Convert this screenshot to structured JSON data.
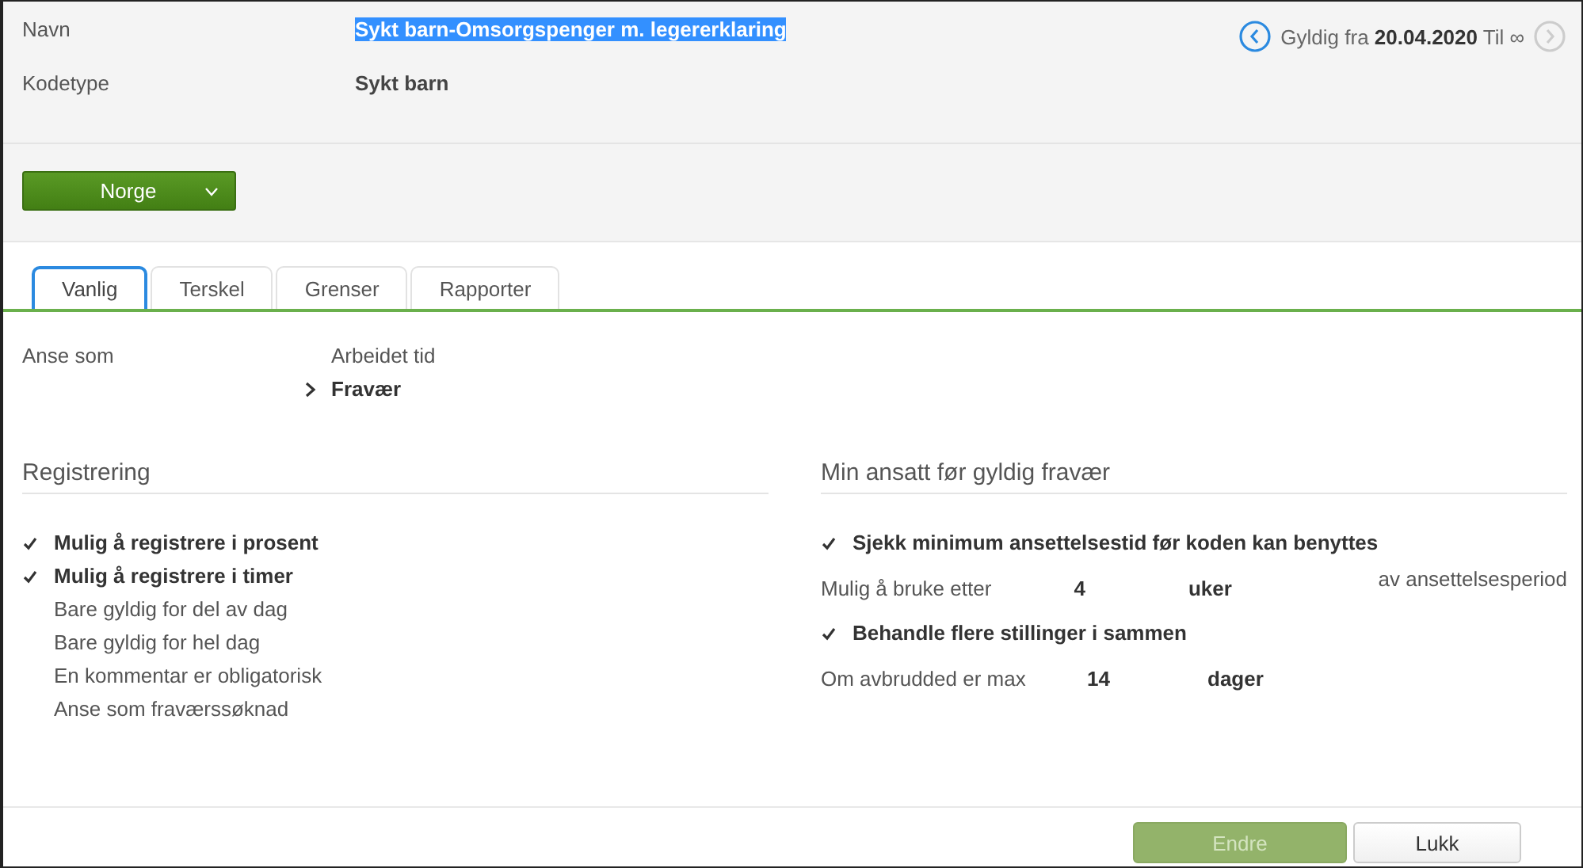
{
  "header": {
    "fields": [
      {
        "label": "Navn",
        "value": "Sykt barn-Omsorgspenger m. legererklaring",
        "highlighted": true
      },
      {
        "label": "Kodetype",
        "value": "Sykt barn",
        "highlighted": false
      }
    ],
    "validity": {
      "prefix": "Gyldig fra",
      "date": "20.04.2020",
      "suffix": "Til ∞",
      "prev_disabled": false,
      "next_disabled": true
    }
  },
  "country_button": {
    "label": "Norge"
  },
  "tabs": [
    {
      "label": "Vanlig",
      "selected": true
    },
    {
      "label": "Terskel",
      "selected": false
    },
    {
      "label": "Grenser",
      "selected": false
    },
    {
      "label": "Rapporter",
      "selected": false
    }
  ],
  "anse_som": {
    "label": "Anse som",
    "options": [
      {
        "label": "Arbeidet tid",
        "selected": false
      },
      {
        "label": "Fravær",
        "selected": true
      }
    ]
  },
  "registrering": {
    "title": "Registrering",
    "items": [
      {
        "label": "Mulig å registrere i prosent",
        "checked": true
      },
      {
        "label": "Mulig å registrere i timer",
        "checked": true
      },
      {
        "label": "Bare gyldig for del av dag",
        "checked": false
      },
      {
        "label": "Bare gyldig for hel dag",
        "checked": false
      },
      {
        "label": "En kommentar er obligatorisk",
        "checked": false
      },
      {
        "label": "Anse som fraværssøknad",
        "checked": false
      }
    ]
  },
  "min_ansatt": {
    "title": "Min ansatt før gyldig fravær",
    "rows": [
      {
        "kind": "check",
        "label": "Sjekk minimum ansettelsestid før koden kan benyttes",
        "checked": true
      },
      {
        "kind": "field",
        "label": "Mulig å bruke etter",
        "value": "4",
        "unit": "uker",
        "note": "av ansettelsesperiod"
      },
      {
        "kind": "check",
        "label": "Behandle flere stillinger i sammen",
        "checked": true
      },
      {
        "kind": "field",
        "label": "Om avbrudded er max",
        "value": "14",
        "unit": "dager"
      }
    ]
  },
  "footer": {
    "buttons": [
      {
        "label": "Endre",
        "disabled": true,
        "kind": "primary"
      },
      {
        "label": "Lukk",
        "disabled": false,
        "kind": "secondary"
      }
    ]
  }
}
